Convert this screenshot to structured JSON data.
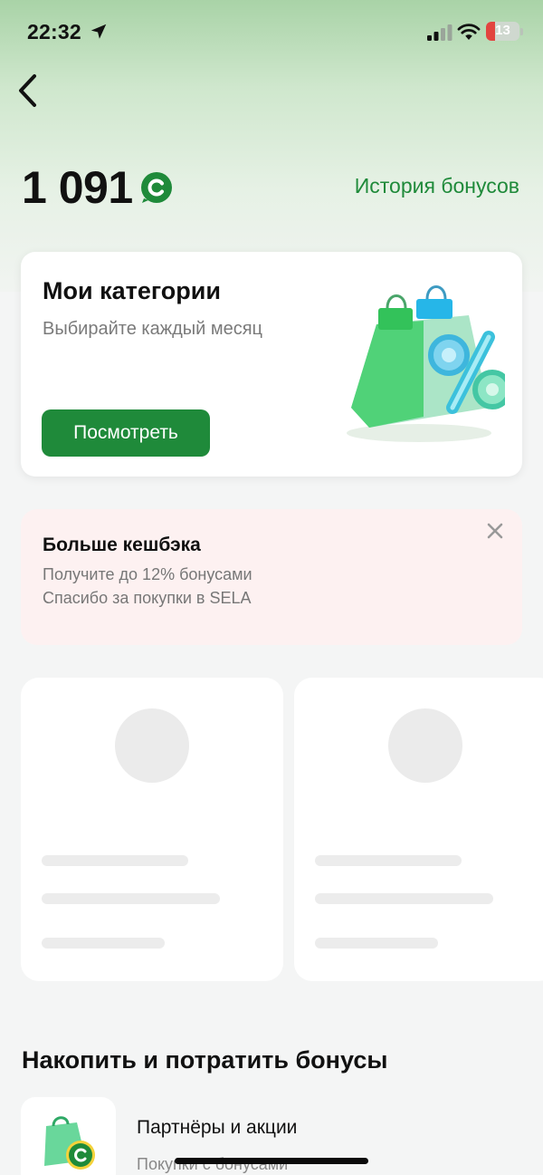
{
  "status_bar": {
    "time": "22:32",
    "battery": "13",
    "icons": [
      "location-arrow-icon",
      "cellular-signal-icon",
      "wifi-icon",
      "battery-icon"
    ]
  },
  "header": {
    "back_icon": "chevron-left-icon",
    "balance": "1 091",
    "bonus_icon": "bonus-coin-icon",
    "history_link": "История бонусов"
  },
  "categories_card": {
    "title": "Мои категории",
    "subtitle": "Выбирайте каждый месяц",
    "button": "Посмотреть",
    "illustration": "shopping-bag-percent-illustration"
  },
  "cashback_banner": {
    "title": "Больше кешбэка",
    "line1": "Получите до 12% бонусами",
    "line2": "Спасибо за покупки в SELA",
    "close_icon": "close-icon"
  },
  "section": {
    "title": "Накопить и потратить бонусы"
  },
  "partners": {
    "title": "Партнёры и акции",
    "subtitle": "Покупки с бонусами",
    "icon": "partner-bag-icon"
  },
  "colors": {
    "accent": "#1f8a3a",
    "banner_bg": "#fdf1f1",
    "gradient_top": "#a9d3a7"
  }
}
